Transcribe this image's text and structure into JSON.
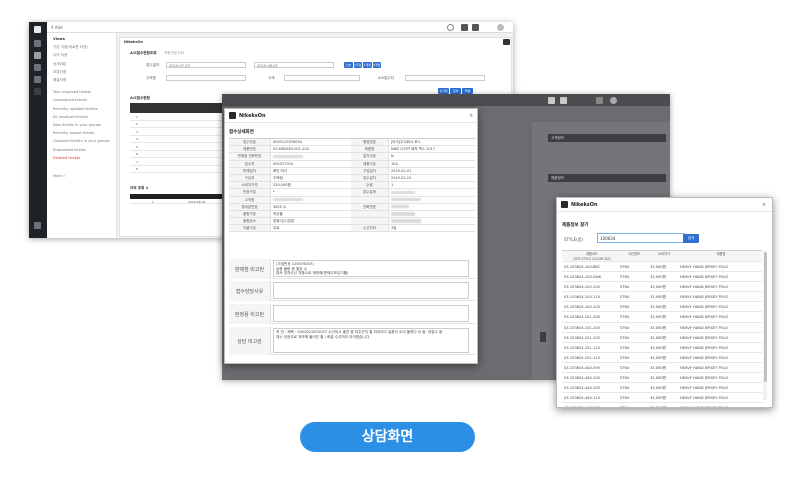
{
  "colors": {
    "accent_blue": "#2b8fe6",
    "button_blue": "#2f6fd1",
    "dark_nav": "#1f2227",
    "overlay_grey": "#6a6c70",
    "alert_red": "#d03a3a"
  },
  "bg_app": {
    "title": "4 Add",
    "sidebar": [
      {
        "label": "Views",
        "head": true
      },
      {
        "label": "기본 지정(새로운 티켓)"
      },
      {
        "label": "나의 티켓"
      },
      {
        "label": "상세리뷰"
      },
      {
        "label": "보류티켓"
      },
      {
        "label": "해결티켓"
      },
      {
        "label": "Your unsolved tickets"
      },
      {
        "label": "Unassigned tickets"
      },
      {
        "label": "Recently updated tickets"
      },
      {
        "label": "All unsolved tickets"
      },
      {
        "label": "New tickets in your groups"
      },
      {
        "label": "Recently solved tickets"
      },
      {
        "label": "Unsolved tickets in your groups"
      },
      {
        "label": "Suspended tickets"
      },
      {
        "label": "Deleted tickets",
        "red": true
      },
      {
        "label": "More »"
      }
    ],
    "panel_title": "NikeksOn",
    "tab_search": "A/S접수현황조회",
    "tab_other": "전화번호조회",
    "filter": {
      "label_date": "접수일자",
      "date_from": "2019-07-25",
      "date_to": "2019-08-01",
      "label_customer": "고객명",
      "label_product": "고객",
      "label_status": "상태",
      "label_phone": "A/S접수처",
      "quick_buttons": [
        "오늘",
        "1주일",
        "1개월",
        "3개월"
      ],
      "action_buttons": [
        "초기화",
        "검색",
        "엑셀"
      ]
    },
    "grid_title": "A/S접수현황",
    "grid_header": [
      "No",
      "고객명",
      "모델",
      "접수번호",
      "상태"
    ],
    "grid_rows": [
      "1",
      "2",
      "3",
      "4",
      "5",
      "6",
      "7",
      "8"
    ],
    "sub_title": "이력 조회 1",
    "sub_header": [
      "No",
      "상담일자"
    ],
    "sub_rows": [
      {
        "no": "1",
        "date": "2019-08-01"
      }
    ]
  },
  "modal1": {
    "title": "NikeksOn",
    "close": "×",
    "section": "접수상세화면",
    "rows": [
      {
        "l1": "접수번호",
        "v1": "0000129376054",
        "l2": "행정법호",
        "v2": "[마크]주식회사 포스"
      },
      {
        "l1": "제품번호",
        "v1": "03-MK0563-001-200",
        "l2": "제품명",
        "v2": "NIKE 나이키 제작 백스 2017"
      },
      {
        "l1": "판매점 전화번호",
        "v1": "",
        "l2": "일자쿠폰",
        "v2": "N"
      },
      {
        "l1": "접수처",
        "v1": "092017020",
        "l2": "제품사유",
        "v2": "1EA"
      },
      {
        "l1": "판매일자",
        "v1": "확인 미가",
        "l2": "구입일자",
        "v2": "2019-02-01"
      },
      {
        "l1": "구입처",
        "v1": "주택점",
        "l2": "접수일자",
        "v2": "2019-02-22"
      },
      {
        "l1": "소비자가격",
        "v1": "220,000원",
        "l2": "수량",
        "v2": "1"
      },
      {
        "l1": "판정구분",
        "v1": "*",
        "l2": "접수유형",
        "v2": ""
      },
      {
        "l1": "고객명",
        "v1": "",
        "l2": "",
        "v2": ""
      },
      {
        "l1": "휴대폰번호",
        "v1": "5825 수",
        "l2": "전화번호",
        "v2": ""
      },
      {
        "l1": "출항구분",
        "v1": "마산율",
        "l2": "",
        "v2": ""
      },
      {
        "l1": "출항장소",
        "v1": "접점이(1)장접",
        "l2": "",
        "v2": ""
      },
      {
        "l1": "이불구분",
        "v1": "무료",
        "l2": "수선처리",
        "v2": "3일"
      }
    ],
    "notes": [
      {
        "label": "판매점 비고란",
        "text": "(가접번호 129376037)\n상품 불량 중 철장 수\n접속 접착수선 처품으로 재판해(판매고포유기를)\n"
      },
      {
        "label": "접수담당사유",
        "text": ""
      },
      {
        "label": "판정용 비고란",
        "text": ""
      },
      {
        "label": "상담 비고란",
        "text": "처 연 : 제목 : 0000012870037 수선되서 출연 중 처주곤지 별 되어오다 질품이 소이 불렀다 요 됨. 재접수 됨\n재시 안공조로 저작해 불러진 할 / 화골 수선처리 되어졌습니다."
      }
    ]
  },
  "modal2": {
    "title": "NikeksOn",
    "close": "×",
    "section": "제품정보 찾기",
    "search_label": "STYLE(품)",
    "search_value": "100634",
    "search_button": "검색",
    "header": [
      "제품코드\n(SPS STYLE COLOR SIZ)",
      "사진정보",
      "소비자가",
      "제품명"
    ],
    "rows": [
      {
        "code": "03-153624-100-BKC",
        "info": "ST6U",
        "price": "33,000원",
        "name": "HEAVY HAND JERSEY POLO"
      },
      {
        "code": "03-153624-100-SWK",
        "info": "ST6U",
        "price": "33,000원",
        "name": "HEAVY HAND JERSEY POLO"
      },
      {
        "code": "03-153624-100-100",
        "info": "ST6U",
        "price": "33,000원",
        "name": "HEAVY HAND JERSEY POLO"
      },
      {
        "code": "03-153624-100-110",
        "info": "ST6U",
        "price": "33,000원",
        "name": "HEAVY HAND JERSEY POLO"
      },
      {
        "code": "03-153624-100-105",
        "info": "ST6U",
        "price": "33,000원",
        "name": "HEAVY HAND JERSEY POLO"
      },
      {
        "code": "03-153624-101-200",
        "info": "ST6U",
        "price": "33,000원",
        "name": "HEAVY HAND JERSEY POLO"
      },
      {
        "code": "03-153624-101-100",
        "info": "ST6U",
        "price": "33,000원",
        "name": "HEAVY HAND JERSEY POLO"
      },
      {
        "code": "03-153624-101-105",
        "info": "ST6U",
        "price": "33,000원",
        "name": "HEAVY HAND JERSEY POLO"
      },
      {
        "code": "03-153624-101-110",
        "info": "ST6U",
        "price": "33,000원",
        "name": "HEAVY HAND JERSEY POLO"
      },
      {
        "code": "03-153624-101-115",
        "info": "ST6U",
        "price": "33,000원",
        "name": "HEAVY HAND JERSEY POLO"
      },
      {
        "code": "03-153624-440-095",
        "info": "ST6U",
        "price": "33,000원",
        "name": "HEAVY HAND JERSEY POLO"
      },
      {
        "code": "03-153624-440-100",
        "info": "ST6U",
        "price": "33,000원",
        "name": "HEAVY HAND JERSEY POLO"
      },
      {
        "code": "03-153624-440-105",
        "info": "ST6U",
        "price": "33,000원",
        "name": "HEAVY HAND JERSEY POLO"
      },
      {
        "code": "03-153624-440-110",
        "info": "ST6U",
        "price": "33,000원",
        "name": "HEAVY HAND JERSEY POLO"
      },
      {
        "code": "03-153624-440-115",
        "info": "ST6U",
        "price": "33,000원",
        "name": "HEAVY HAND JERSEY POLO"
      }
    ]
  },
  "overlay": {
    "panel_label_1": "고객정보",
    "panel_label_2": "제품정보"
  },
  "caption": "상담화면"
}
